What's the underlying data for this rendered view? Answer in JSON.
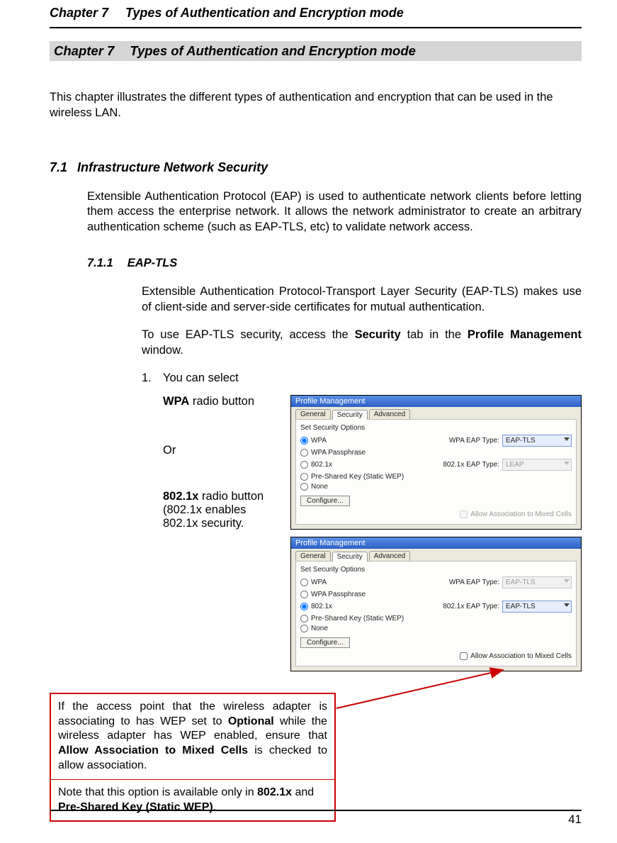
{
  "running_head": {
    "num": "Chapter 7",
    "title": "Types of Authentication and Encryption mode"
  },
  "chapter_bar": {
    "num": "Chapter 7",
    "title": "Types of Authentication and Encryption mode"
  },
  "intro": "This chapter illustrates the different types of authentication and encryption that can be used in the wireless LAN.",
  "section": {
    "num": "7.1",
    "title": "Infrastructure Network Security",
    "body": "Extensible Authentication Protocol (EAP) is used to authenticate network clients before letting them access the enterprise network. It allows the network administrator to create an arbitrary authentication scheme (such as EAP-TLS, etc) to validate network access."
  },
  "subsection": {
    "num": "7.1.1",
    "title": "EAP-TLS",
    "p1": "Extensible Authentication Protocol-Transport Layer Security (EAP-TLS) makes use of client-side and server-side certificates for mutual authentication.",
    "p2_a": "To use EAP-TLS security, access the ",
    "p2_b": "Security",
    "p2_c": " tab in the ",
    "p2_d": "Profile Management",
    "p2_e": " window."
  },
  "list": {
    "num": "1.",
    "text": "You can select",
    "wpa_b": "WPA",
    "wpa_t": " radio button",
    "or": "Or",
    "x_b": "802.1x",
    "x_t": " radio button",
    "x_note": "(802.1x enables 802.1x security."
  },
  "shots": {
    "title": "Profile Management",
    "tabs": {
      "general": "General",
      "security": "Security",
      "advanced": "Advanced"
    },
    "grp": "Set Security Options",
    "opts": {
      "wpa": "WPA",
      "wpapass": "WPA Passphrase",
      "dotx": "802.1x",
      "psk": "Pre-Shared Key (Static WEP)",
      "none": "None"
    },
    "labels": {
      "wpa_eap": "WPA EAP Type:",
      "dotx_eap": "802.1x EAP Type:"
    },
    "combos": {
      "eaptls": "EAP-TLS",
      "leap": "LEAP"
    },
    "btn": "Configure...",
    "chk": "Allow Association to Mixed Cells"
  },
  "note": {
    "p1_a": "If the access point that the wireless adapter is associating to has WEP set to ",
    "p1_b": "Optional",
    "p1_c": " while the wireless adapter has WEP enabled, ensure that ",
    "p1_d": "Allow Association to Mixed Cells",
    "p1_e": " is checked to allow association.",
    "p2_a": "Note that this option is available only in ",
    "p2_b": "802.1x",
    "p2_c": " and ",
    "p2_d": "Pre-Shared Key (Static WEP)",
    "p2_e": "."
  },
  "pagenum": "41"
}
